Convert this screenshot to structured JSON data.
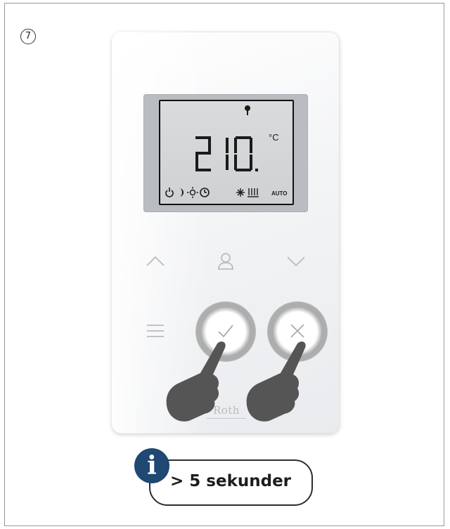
{
  "step": {
    "number": "7"
  },
  "thermostat": {
    "display": {
      "temperature": "21.0",
      "unit": "°C",
      "mode_auto_label": "AUTO",
      "icons": [
        "antenna-icon",
        "standby-icon",
        "night-icon",
        "day-icon",
        "timer-icon",
        "cooling-icon",
        "heating-icon"
      ]
    },
    "buttons": {
      "up": "chevron-up-icon",
      "user": "user-icon",
      "down": "chevron-down-icon",
      "menu": "menu-icon",
      "confirm": "check-icon",
      "cancel": "close-icon"
    },
    "brand": "Roth"
  },
  "note": {
    "text": "> 5 sekunder",
    "icon": "i"
  },
  "colors": {
    "info_accent": "#1f4873",
    "lcd_background": "#d3d5d6",
    "hand": "#555555"
  }
}
